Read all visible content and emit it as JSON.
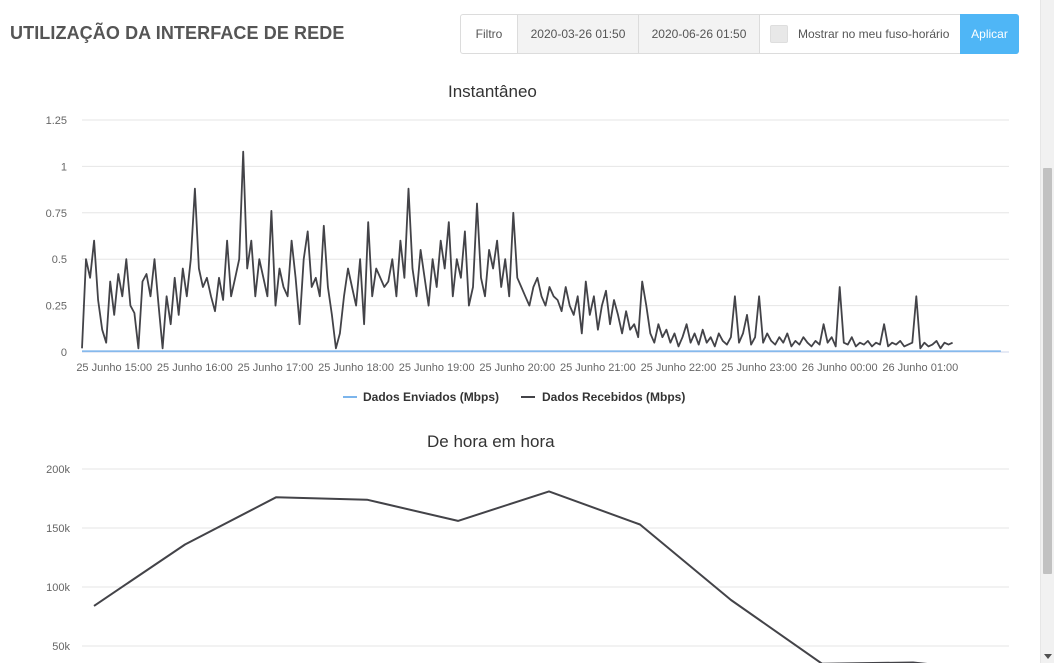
{
  "page": {
    "title": "UTILIZAÇÃO DA INTERFACE DE REDE"
  },
  "filter": {
    "label": "Filtro",
    "start_date": "2020-03-26 01:50",
    "end_date": "2020-06-26 01:50",
    "timezone_label": "Mostrar no meu fuso-horário",
    "timezone_checked": false,
    "apply_label": "Aplicar",
    "apply_color": "#4fb6f6"
  },
  "chart_data": [
    {
      "type": "line",
      "title": "Instantâneo",
      "ylim": [
        0,
        1.25
      ],
      "yticks": [
        "0",
        "0.25",
        "0.5",
        "0.75",
        "1",
        "1.25"
      ],
      "x_tick_labels": [
        "25 Junho 15:00",
        "25 Junho 16:00",
        "25 Junho 17:00",
        "25 Junho 18:00",
        "25 Junho 19:00",
        "25 Junho 20:00",
        "25 Junho 21:00",
        "25 Junho 22:00",
        "25 Junho 23:00",
        "26 Junho 00:00",
        "26 Junho 01:00"
      ],
      "x_range_hours": [
        14.6,
        26.1
      ],
      "grid": true,
      "legend_position": "bottom",
      "series": [
        {
          "name": "Dados Enviados (Mbps)",
          "color": "#7cb5ec",
          "x_hours": [
            14.6,
            26.0
          ],
          "values": [
            0.005,
            0.005
          ]
        },
        {
          "name": "Dados Recebidos (Mbps)",
          "color": "#434348",
          "x_hours": [
            14.6,
            14.65,
            14.7,
            14.75,
            14.8,
            14.85,
            14.9,
            14.95,
            15.0,
            15.05,
            15.1,
            15.15,
            15.2,
            15.25,
            15.3,
            15.35,
            15.4,
            15.45,
            15.5,
            15.55,
            15.6,
            15.65,
            15.7,
            15.75,
            15.8,
            15.85,
            15.9,
            15.95,
            16.0,
            16.05,
            16.1,
            16.15,
            16.2,
            16.25,
            16.3,
            16.35,
            16.4,
            16.45,
            16.5,
            16.55,
            16.6,
            16.65,
            16.7,
            16.75,
            16.8,
            16.85,
            16.9,
            16.95,
            17.0,
            17.05,
            17.1,
            17.15,
            17.2,
            17.25,
            17.3,
            17.35,
            17.4,
            17.45,
            17.5,
            17.55,
            17.6,
            17.65,
            17.7,
            17.75,
            17.8,
            17.85,
            17.9,
            17.95,
            18.0,
            18.05,
            18.1,
            18.15,
            18.2,
            18.25,
            18.3,
            18.35,
            18.4,
            18.45,
            18.5,
            18.55,
            18.6,
            18.65,
            18.7,
            18.75,
            18.8,
            18.85,
            18.9,
            18.95,
            19.0,
            19.05,
            19.1,
            19.15,
            19.2,
            19.25,
            19.3,
            19.35,
            19.4,
            19.45,
            19.5,
            19.55,
            19.6,
            19.65,
            19.7,
            19.75,
            19.8,
            19.85,
            19.9,
            19.95,
            20.0,
            20.05,
            20.1,
            20.15,
            20.2,
            20.25,
            20.3,
            20.35,
            20.4,
            20.45,
            20.5,
            20.55,
            20.6,
            20.65,
            20.7,
            20.75,
            20.8,
            20.85,
            20.9,
            20.95,
            21.0,
            21.05,
            21.1,
            21.15,
            21.2,
            21.25,
            21.3,
            21.35,
            21.4,
            21.45,
            21.5,
            21.55,
            21.6,
            21.65,
            21.7,
            21.75,
            21.8,
            21.85,
            21.9,
            21.95,
            22.0,
            22.05,
            22.1,
            22.15,
            22.2,
            22.25,
            22.3,
            22.35,
            22.4,
            22.45,
            22.5,
            22.55,
            22.6,
            22.65,
            22.7,
            22.75,
            22.8,
            22.85,
            22.9,
            22.95,
            23.0,
            23.05,
            23.1,
            23.15,
            23.2,
            23.25,
            23.3,
            23.35,
            23.4,
            23.45,
            23.5,
            23.55,
            23.6,
            23.65,
            23.7,
            23.75,
            23.8,
            23.85,
            23.9,
            23.95,
            24.0,
            24.05,
            24.1,
            24.15,
            24.2,
            24.25,
            24.3,
            24.35,
            24.4,
            24.45,
            24.5,
            24.55,
            24.6,
            24.65,
            24.7,
            24.75,
            24.8,
            24.85,
            24.9,
            24.95,
            25.0,
            25.05,
            25.1,
            25.15,
            25.2,
            25.25,
            25.3,
            25.35,
            25.4,
            25.45,
            25.5,
            25.55,
            25.6,
            25.65,
            25.7,
            25.75,
            25.8,
            25.85,
            25.9,
            25.95,
            26.0
          ],
          "values": [
            0.02,
            0.5,
            0.4,
            0.6,
            0.28,
            0.12,
            0.05,
            0.38,
            0.2,
            0.42,
            0.3,
            0.5,
            0.25,
            0.21,
            0.02,
            0.38,
            0.42,
            0.3,
            0.5,
            0.25,
            0.02,
            0.3,
            0.15,
            0.4,
            0.2,
            0.45,
            0.3,
            0.5,
            0.88,
            0.45,
            0.35,
            0.4,
            0.3,
            0.22,
            0.4,
            0.28,
            0.6,
            0.3,
            0.4,
            0.5,
            1.08,
            0.45,
            0.6,
            0.3,
            0.5,
            0.4,
            0.3,
            0.76,
            0.25,
            0.45,
            0.35,
            0.3,
            0.6,
            0.4,
            0.15,
            0.5,
            0.65,
            0.35,
            0.4,
            0.3,
            0.68,
            0.35,
            0.2,
            0.02,
            0.1,
            0.3,
            0.45,
            0.35,
            0.25,
            0.5,
            0.15,
            0.7,
            0.3,
            0.45,
            0.4,
            0.35,
            0.38,
            0.5,
            0.3,
            0.6,
            0.4,
            0.88,
            0.45,
            0.3,
            0.55,
            0.4,
            0.25,
            0.5,
            0.35,
            0.6,
            0.45,
            0.7,
            0.3,
            0.5,
            0.4,
            0.65,
            0.25,
            0.35,
            0.8,
            0.4,
            0.3,
            0.55,
            0.45,
            0.6,
            0.35,
            0.5,
            0.3,
            0.75,
            0.4,
            0.35,
            0.3,
            0.25,
            0.35,
            0.4,
            0.3,
            0.25,
            0.35,
            0.3,
            0.28,
            0.22,
            0.35,
            0.25,
            0.2,
            0.3,
            0.1,
            0.38,
            0.2,
            0.3,
            0.12,
            0.25,
            0.33,
            0.15,
            0.28,
            0.2,
            0.1,
            0.22,
            0.12,
            0.15,
            0.08,
            0.38,
            0.25,
            0.1,
            0.05,
            0.15,
            0.08,
            0.12,
            0.05,
            0.1,
            0.03,
            0.08,
            0.15,
            0.05,
            0.1,
            0.04,
            0.12,
            0.05,
            0.08,
            0.03,
            0.1,
            0.06,
            0.04,
            0.08,
            0.3,
            0.05,
            0.1,
            0.2,
            0.04,
            0.08,
            0.3,
            0.05,
            0.1,
            0.06,
            0.04,
            0.08,
            0.05,
            0.1,
            0.03,
            0.06,
            0.04,
            0.08,
            0.05,
            0.03,
            0.06,
            0.04,
            0.15,
            0.05,
            0.08,
            0.03,
            0.35,
            0.05,
            0.04,
            0.08,
            0.03,
            0.05,
            0.04,
            0.06,
            0.03,
            0.05,
            0.04,
            0.15,
            0.03,
            0.05,
            0.04,
            0.06,
            0.03,
            0.04,
            0.05,
            0.3,
            0.02,
            0.05,
            0.03,
            0.04,
            0.06,
            0.02,
            0.05,
            0.04,
            0.05
          ]
        }
      ]
    },
    {
      "type": "line",
      "title": "De hora em hora",
      "ylim": [
        0,
        200000
      ],
      "yticks": [
        "50k",
        "100k",
        "150k",
        "200k"
      ],
      "grid": true,
      "series": [
        {
          "color": "#434348",
          "values": [
            84000,
            136000,
            176000,
            174000,
            156000,
            181000,
            153000,
            89000,
            35000,
            36000,
            28000
          ]
        }
      ]
    }
  ]
}
